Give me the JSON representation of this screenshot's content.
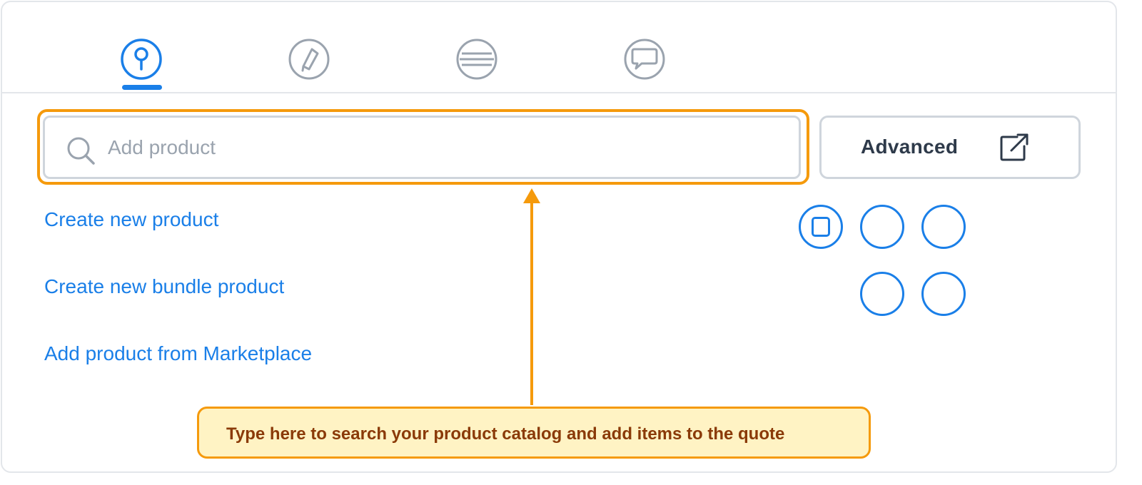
{
  "tabs": [
    {
      "icon": "pin-icon",
      "active": true
    },
    {
      "icon": "pencil-icon",
      "active": false
    },
    {
      "icon": "list-icon",
      "active": false
    },
    {
      "icon": "chat-bubble-icon",
      "active": false
    }
  ],
  "search": {
    "placeholder": "Add product",
    "value": ""
  },
  "advanced": {
    "label": "Advanced",
    "icon": "external-link-icon"
  },
  "links": [
    {
      "label": "Create new product"
    },
    {
      "label": "Create new bundle product"
    },
    {
      "label": "Add product from Marketplace"
    }
  ],
  "action_circles": [
    {
      "icon": "square-icon"
    },
    {
      "icon": "none"
    },
    {
      "icon": "none"
    },
    {
      "icon": "none"
    },
    {
      "icon": "none"
    }
  ],
  "callout": {
    "text": "Type here to search your product catalog and add items to the quote"
  },
  "colors": {
    "accent": "#1a7fe8",
    "highlight": "#f59a0c",
    "callout_bg": "#fff3c4",
    "callout_text": "#8a3a08",
    "inactive_icon": "#9aa3ae",
    "border": "#cfd5dc"
  }
}
